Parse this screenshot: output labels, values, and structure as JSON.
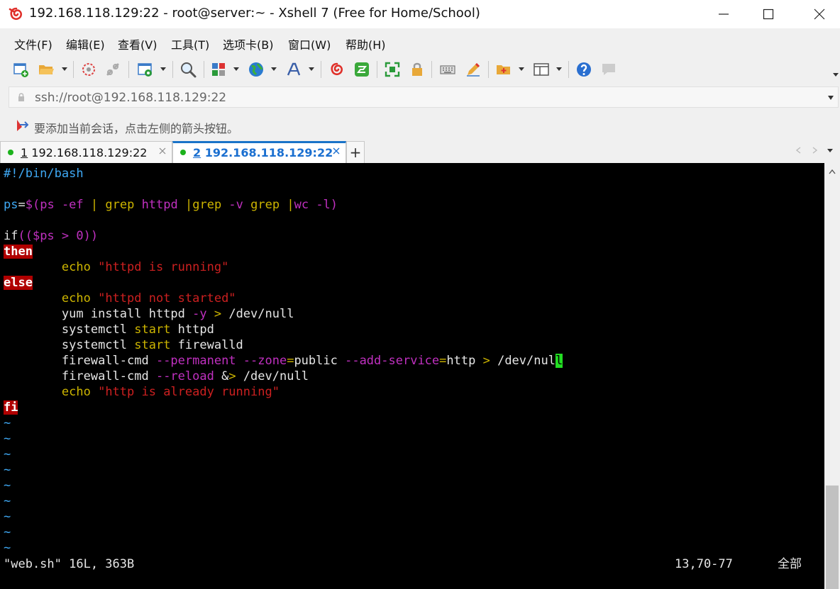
{
  "window": {
    "title": "192.168.118.129:22 - root@server:~ - Xshell 7 (Free for Home/School)"
  },
  "menu": [
    "文件(F)",
    "编辑(E)",
    "查看(V)",
    "工具(T)",
    "选项卡(B)",
    "窗口(W)",
    "帮助(H)"
  ],
  "address": {
    "value": "ssh://root@192.168.118.129:22"
  },
  "info": {
    "text": "要添加当前会话，点击左侧的箭头按钮。"
  },
  "tabs": [
    {
      "num": "1",
      "label": " 192.168.118.129:22",
      "active": false
    },
    {
      "num": "2",
      "label": " 192.168.118.129:22",
      "active": true
    }
  ],
  "colors": {
    "terminal_bg": "#000000",
    "keyword_bg": "#b00000",
    "cursor": "#22dd22",
    "tab_active": "#1a73c8"
  },
  "terminal": {
    "l1": "#!/bin/bash",
    "l2_var": "ps",
    "l2_eq": "=",
    "l2_sub_open": "$(",
    "l2_cmd": "ps",
    "l2_flag1": " -ef ",
    "l2_pipe1": "|",
    "l2_grep1": " grep",
    "l2_arg1": " httpd ",
    "l2_pipe2": "|",
    "l2_grep2": "grep",
    "l2_flag2": " -v ",
    "l2_grep3": "grep",
    "l2_sp": " ",
    "l2_pipe3": "|",
    "l2_wc": "wc",
    "l2_flag3": " -l)",
    "l3_if": "if",
    "l3_rest": "(($ps > 0))",
    "l4": "then",
    "l5_echo": "echo",
    "l5_str": " \"httpd is running\"",
    "l6": "else",
    "l7_echo": "echo",
    "l7_str": " \"httpd not started\"",
    "l8_a": "yum install httpd ",
    "l8_b": "-y",
    "l8_c": " > ",
    "l8_d": "/dev/null",
    "l9_a": "systemctl ",
    "l9_b": "start",
    "l9_c": " httpd",
    "l10_a": "systemctl ",
    "l10_b": "start",
    "l10_c": " firewalld",
    "l11_a": "firewall-cmd ",
    "l11_b": "--permanent --zone",
    "l11_c": "=",
    "l11_d": "public ",
    "l11_e": "--add-service",
    "l11_f": "=",
    "l11_g": "http ",
    "l11_h": ">",
    "l11_i": " /dev/nul",
    "l11_cursor": "l",
    "l12_a": "firewall-cmd ",
    "l12_b": "--reload",
    "l12_c": " &",
    "l12_d": ">",
    "l12_e": " /dev/null",
    "l13_echo": "echo",
    "l13_str": " \"http is already running\"",
    "l14": "fi",
    "tilde": "~",
    "status_file": "\"web.sh\" 16L, 363B",
    "status_pos": "13,70-77",
    "status_all": "全部"
  }
}
